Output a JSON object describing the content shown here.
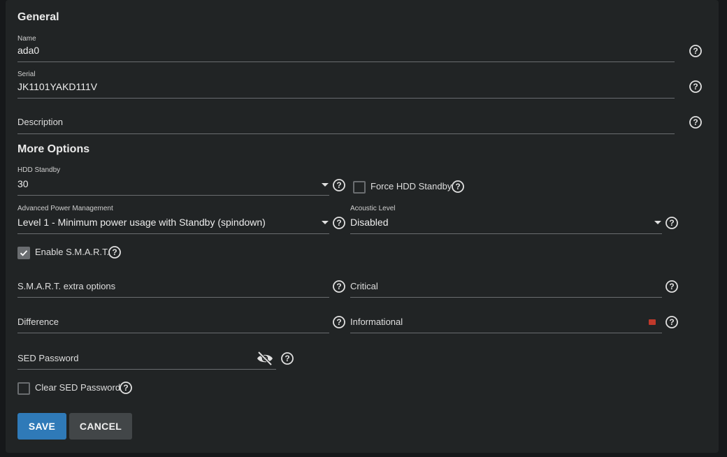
{
  "general": {
    "heading": "General",
    "name_label": "Name",
    "name_value": "ada0",
    "serial_label": "Serial",
    "serial_value": "JK1101YAKD111V",
    "description_label": "Description"
  },
  "more_options": {
    "heading": "More Options",
    "hdd_standby_label": "HDD Standby",
    "hdd_standby_value": "30",
    "force_hdd_standby_label": "Force HDD Standby",
    "force_hdd_standby_checked": false,
    "apm_label": "Advanced Power Management",
    "apm_value": "Level 1 - Minimum power usage with Standby (spindown)",
    "acoustic_label": "Acoustic Level",
    "acoustic_value": "Disabled",
    "enable_smart_label": "Enable S.M.A.R.T.",
    "enable_smart_checked": true,
    "smart_extra_label": "S.M.A.R.T. extra options",
    "critical_label": "Critical",
    "difference_label": "Difference",
    "informational_label": "Informational",
    "sed_password_label": "SED Password",
    "clear_sed_label": "Clear SED Password",
    "clear_sed_checked": false
  },
  "actions": {
    "save_label": "SAVE",
    "cancel_label": "CANCEL"
  },
  "icons": {
    "help": "help-circle-icon",
    "dropdown": "caret-down-icon",
    "visibility": "eye-off-icon"
  },
  "colors": {
    "background": "#16181a",
    "card": "#212425",
    "primary": "#2f7ab8",
    "secondary_button": "#424648",
    "stepper_error": "#c0392b"
  }
}
